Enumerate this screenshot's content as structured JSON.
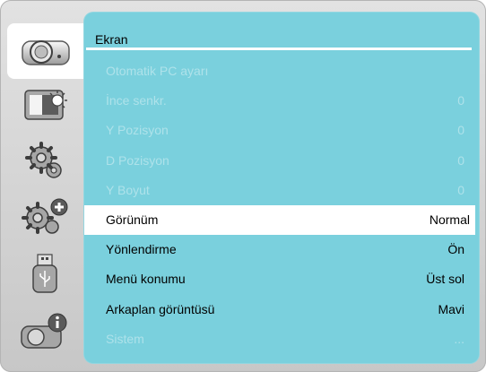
{
  "sidebar": {
    "tabs": [
      {
        "icon": "projector-icon",
        "active": true
      },
      {
        "icon": "display-brightness-icon",
        "active": false
      },
      {
        "icon": "gear-icon",
        "active": false
      },
      {
        "icon": "gear-plus-icon",
        "active": false
      },
      {
        "icon": "usb-icon",
        "active": false
      },
      {
        "icon": "projector-info-icon",
        "active": false
      }
    ]
  },
  "panel": {
    "title": "Ekran",
    "rows": [
      {
        "label": "Otomatik PC ayarı",
        "value": "",
        "state": "disabled"
      },
      {
        "label": "İnce senkr.",
        "value": "0",
        "state": "disabled"
      },
      {
        "label": "Y Pozisyon",
        "value": "0",
        "state": "disabled"
      },
      {
        "label": "D Pozisyon",
        "value": "0",
        "state": "disabled"
      },
      {
        "label": "Y Boyut",
        "value": "0",
        "state": "disabled"
      },
      {
        "label": "Görünüm",
        "value": "Normal",
        "state": "selected"
      },
      {
        "label": "Yönlendirme",
        "value": "Ön",
        "state": "enabled"
      },
      {
        "label": "Menü konumu",
        "value": "Üst sol",
        "state": "enabled"
      },
      {
        "label": "Arkaplan görüntüsü",
        "value": "Mavi",
        "state": "enabled"
      },
      {
        "label": "Sistem",
        "value": "...",
        "state": "disabled"
      }
    ]
  },
  "colors": {
    "panel_bg": "#7ad0dd",
    "disabled_text": "#aee2ea",
    "selected_bg": "#ffffff",
    "frame": "#d6d6d6"
  }
}
